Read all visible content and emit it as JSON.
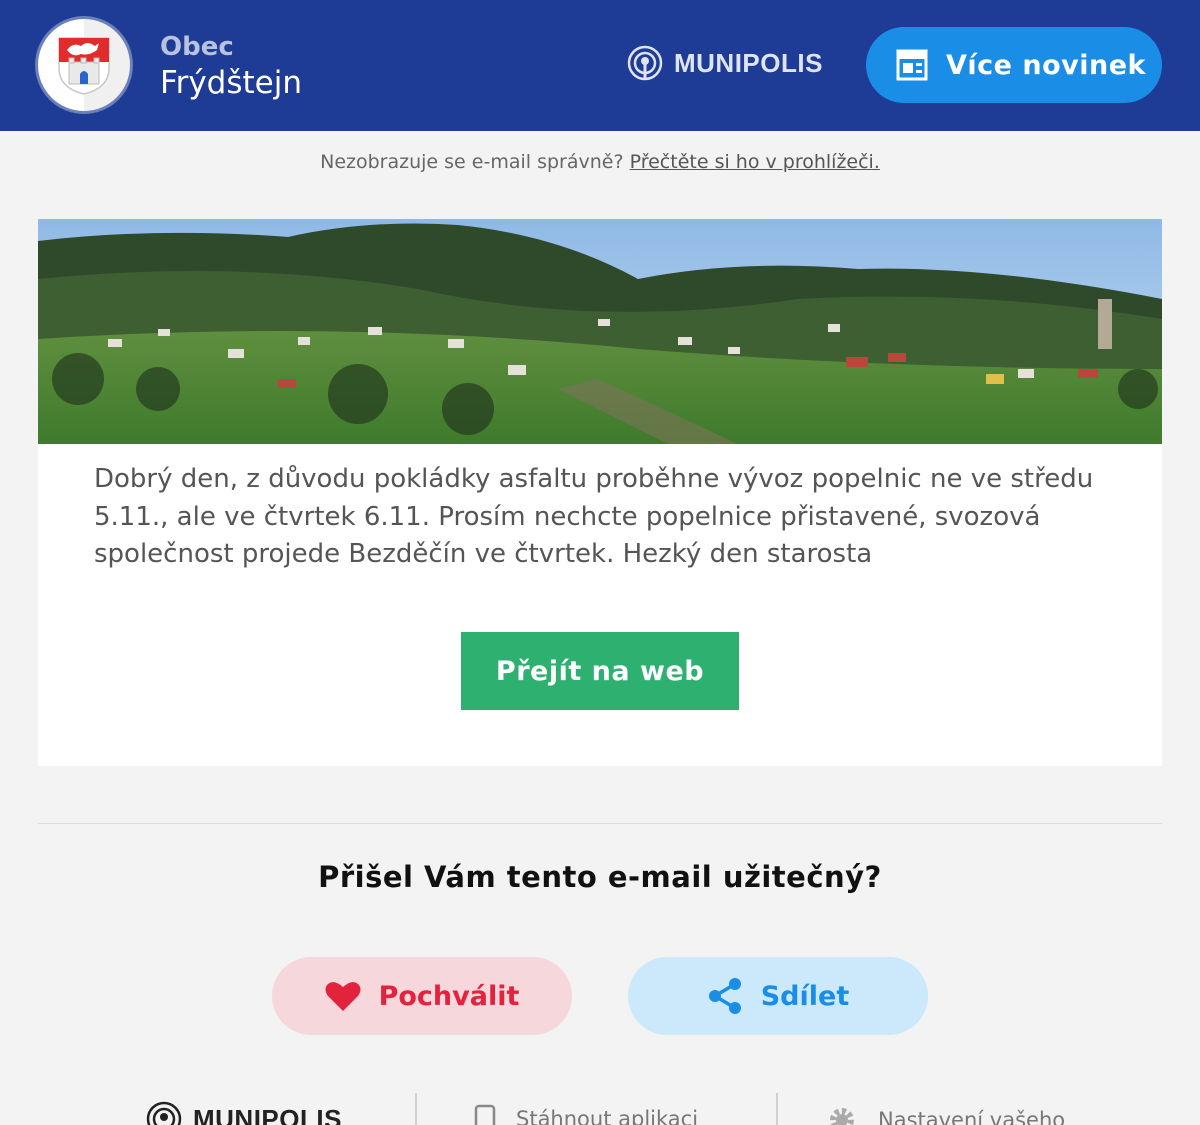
{
  "header": {
    "town_prefix": "Obec",
    "town_name": "Frýdštejn",
    "brand": "MUNIPOLIS",
    "more_news_label": "Více novinek",
    "crest_icon": "coat-of-arms-icon"
  },
  "preheader": {
    "text": "Nezobrazuje se e-mail správně?",
    "link_text": "Přečtěte si ho v prohlížeči."
  },
  "message": {
    "body": "Dobrý den, z důvodu pokládky asfaltu proběhne vývoz popelnic ne ve středu 5.11., ale ve čtvrtek 6.11. Prosím nechcte popelnice přistavené, svozová společnost projede Bezděčín ve čtvrtek. Hezký den starosta",
    "button_label": "Přejít na web"
  },
  "feedback": {
    "question": "Přišel Vám tento e-mail užitečný?",
    "praise_label": "Pochválit",
    "share_label": "Sdílet"
  },
  "footer": {
    "brand": "MUNIPOLIS",
    "download_app": "Stáhnout aplikaci",
    "settings": "Nastavení vašeho"
  },
  "colors": {
    "header_bg": "#1e3c96",
    "accent_blue": "#1a8ee6",
    "web_button": "#2eb070",
    "praise_red": "#e3223e",
    "page_bg": "#f3f3f3"
  }
}
